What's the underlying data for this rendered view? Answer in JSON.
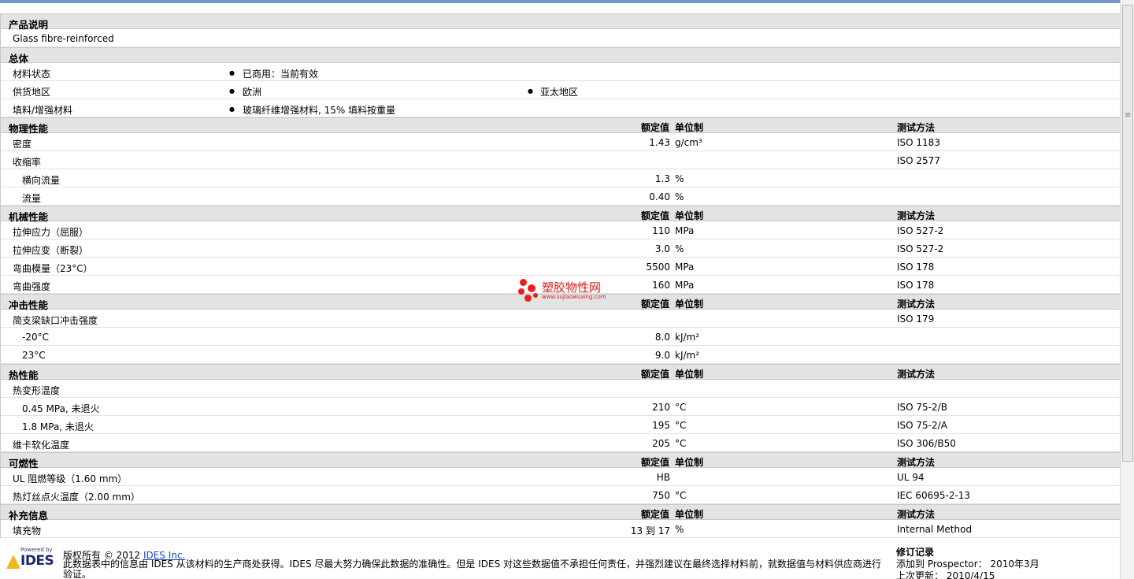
{
  "sections": {
    "product_desc": {
      "title": "产品说明",
      "text": "Glass fibre-reinforced"
    },
    "general": {
      "title": "总体",
      "rows": [
        {
          "label": "材料状态",
          "v1": "已商用：当前有效",
          "v2": ""
        },
        {
          "label": "供货地区",
          "v1": "欧洲",
          "v2": "亚太地区"
        },
        {
          "label": "填料/增强材料",
          "v1": "玻璃纤维增强材料, 15% 填料按重量",
          "v2": ""
        }
      ]
    },
    "headers": {
      "nominal": "额定值",
      "unit": "单位制",
      "test": "测试方法"
    },
    "physical": {
      "title": "物理性能",
      "rows": [
        {
          "name": "密度",
          "val": "1.43",
          "unit": "g/cm³",
          "test": "ISO 1183"
        },
        {
          "name": "收缩率",
          "val": "",
          "unit": "",
          "test": "ISO 2577"
        },
        {
          "name": "横向流量",
          "val": "1.3",
          "unit": "%",
          "test": ""
        },
        {
          "name": "流量",
          "val": "0.40",
          "unit": "%",
          "test": ""
        }
      ]
    },
    "mechanical": {
      "title": "机械性能",
      "rows": [
        {
          "name": "拉伸应力（屈服）",
          "val": "110",
          "unit": "MPa",
          "test": "ISO 527-2"
        },
        {
          "name": "拉伸应变（断裂）",
          "val": "3.0",
          "unit": "%",
          "test": "ISO 527-2"
        },
        {
          "name": "弯曲模量（23°C）",
          "val": "5500",
          "unit": "MPa",
          "test": "ISO 178"
        },
        {
          "name": "弯曲强度",
          "val": "160",
          "unit": "MPa",
          "test": "ISO 178"
        }
      ]
    },
    "impact": {
      "title": "冲击性能",
      "rows": [
        {
          "name": "简支梁缺口冲击强度",
          "val": "",
          "unit": "",
          "test": "ISO 179"
        },
        {
          "name": "-20°C",
          "val": "8.0",
          "unit": "kJ/m²",
          "test": ""
        },
        {
          "name": "23°C",
          "val": "9.0",
          "unit": "kJ/m²",
          "test": ""
        }
      ]
    },
    "thermal": {
      "title": "热性能",
      "rows": [
        {
          "name": "热变形温度",
          "val": "",
          "unit": "",
          "test": ""
        },
        {
          "name": "0.45 MPa, 未退火",
          "val": "210",
          "unit": "°C",
          "test": "ISO 75-2/B"
        },
        {
          "name": "1.8 MPa, 未退火",
          "val": "195",
          "unit": "°C",
          "test": "ISO 75-2/A"
        },
        {
          "name": "维卡软化温度",
          "val": "205",
          "unit": "°C",
          "test": "ISO 306/B50"
        }
      ]
    },
    "flammability": {
      "title": "可燃性",
      "rows": [
        {
          "name": "UL 阻燃等级（1.60 mm）",
          "val": "HB",
          "unit": "",
          "test": "UL 94"
        },
        {
          "name": "热灯丝点火温度（2.00 mm）",
          "val": "750",
          "unit": "°C",
          "test": "IEC 60695-2-13"
        }
      ]
    },
    "supplemental": {
      "title": "补充信息",
      "rows": [
        {
          "name": "填充物",
          "val": "13 到  17",
          "unit": "%",
          "test": "Internal Method"
        }
      ]
    }
  },
  "footer": {
    "logo_powered": "Powered by",
    "logo_name": "IDES",
    "copyright": "版权所有 © 2012",
    "company_link": "IDES Inc.",
    "disclaimer": "此数据表中的信息由 IDES 从该材料的生产商处获得。IDES 尽最大努力确保此数据的准确性。但是 IDES 对这些数据值不承担任何责任，并强烈建议在最终选择材料前，就数据值与材料供应商进行验证。",
    "revision_title": "修订记录",
    "added_line": "添加到  Prospector：  2010年3月",
    "updated_line": "上次更新：  2010/4/15"
  },
  "watermark": {
    "text": "塑胶物性网",
    "url": "www.sujiaowuxing.com"
  },
  "colors": {
    "section_bg": "#e3e3e3",
    "accent_bar": "#6f9ac6",
    "watermark_red": "#e8211f"
  }
}
